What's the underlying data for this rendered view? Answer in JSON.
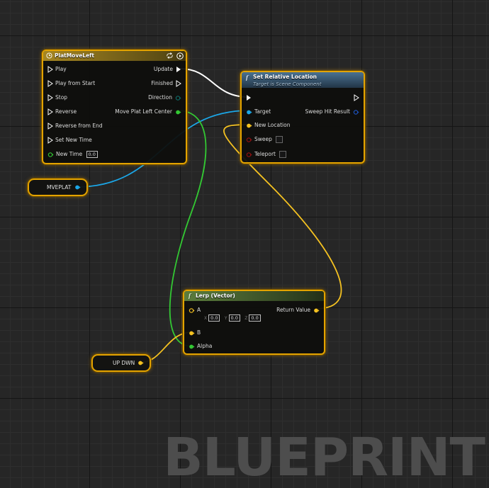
{
  "watermark": "BLUEPRINT",
  "timeline_node": {
    "title": "PlatMoveLeft",
    "header_icons": [
      "clock-icon",
      "loop-icon",
      "play-circle-icon"
    ],
    "inputs": [
      "Play",
      "Play from Start",
      "Stop",
      "Reverse",
      "Reverse from End",
      "Set New Time"
    ],
    "new_time_label": "New Time",
    "new_time_value": "0.0",
    "outputs": [
      "Update",
      "Finished",
      "Direction",
      "Move Plat Left Center"
    ]
  },
  "set_relative_node": {
    "title": "Set Relative Location",
    "subtitle": "Target is Scene Component",
    "inputs": [
      "Target",
      "New Location",
      "Sweep",
      "Teleport"
    ],
    "outputs": [
      "Sweep Hit Result"
    ]
  },
  "lerp_node": {
    "title": "Lerp (Vector)",
    "input_a": "A",
    "a_x_label": "X",
    "a_x_value": "0.0",
    "a_y_label": "Y",
    "a_y_value": "0.0",
    "a_z_label": "Z",
    "a_z_value": "0.0",
    "input_b": "B",
    "input_alpha": "Alpha",
    "output": "Return Value"
  },
  "mveplat_var": {
    "label": "MVEPLAT"
  },
  "updwn_var": {
    "label": "UP DWN"
  },
  "colors": {
    "exec": "#ffffff",
    "object": "#1ba7e8",
    "vector": "#f5c221",
    "float": "#33c733",
    "boolean": "#9a1010",
    "struct": "#1d55c5",
    "node_border": "#e3a300",
    "grid_bg": "#262626"
  }
}
